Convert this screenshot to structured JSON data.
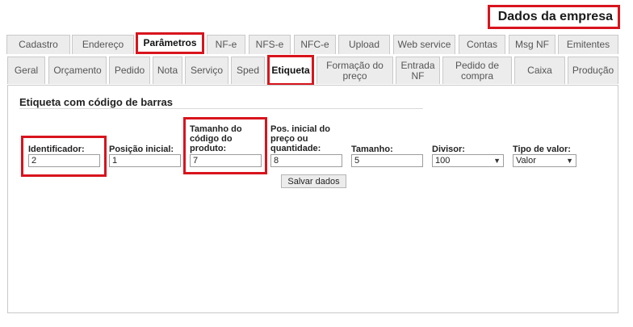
{
  "page": {
    "title": "Dados da empresa"
  },
  "main_tabs": [
    {
      "label": "Cadastro"
    },
    {
      "label": "Endereço"
    },
    {
      "label": "Parâmetros"
    },
    {
      "label": "NF-e"
    },
    {
      "label": "NFS-e"
    },
    {
      "label": "NFC-e"
    },
    {
      "label": "Upload"
    },
    {
      "label": "Web service"
    },
    {
      "label": "Contas"
    },
    {
      "label": "Msg NF"
    },
    {
      "label": "Emitentes"
    }
  ],
  "sub_tabs": [
    {
      "label": "Geral"
    },
    {
      "label": "Orçamento"
    },
    {
      "label": "Pedido"
    },
    {
      "label": "Nota"
    },
    {
      "label": "Serviço"
    },
    {
      "label": "Sped"
    },
    {
      "label": "Etiqueta"
    },
    {
      "label": "Formação do preço"
    },
    {
      "label": "Entrada NF"
    },
    {
      "label": "Pedido de compra"
    },
    {
      "label": "Caixa"
    },
    {
      "label": "Produção"
    }
  ],
  "section": {
    "title": "Etiqueta com código de barras"
  },
  "fields": {
    "identificador": {
      "label": "Identificador:",
      "value": "2"
    },
    "posicao_inicial": {
      "label": "Posição inicial:",
      "value": "1"
    },
    "tamanho_codigo": {
      "label": "Tamanho do código do produto:",
      "value": "7"
    },
    "pos_inicial_preco": {
      "label": "Pos. inicial do preço ou quantidade:",
      "value": "8"
    },
    "tamanho": {
      "label": "Tamanho:",
      "value": "5"
    },
    "divisor": {
      "label": "Divisor:",
      "value": "100"
    },
    "tipo_valor": {
      "label": "Tipo de valor:",
      "value": "Valor"
    }
  },
  "save_button": {
    "label": "Salvar dados"
  },
  "colors": {
    "highlight": "#d8141d",
    "tab_bg": "#ececec",
    "border": "#c9c9c9"
  }
}
